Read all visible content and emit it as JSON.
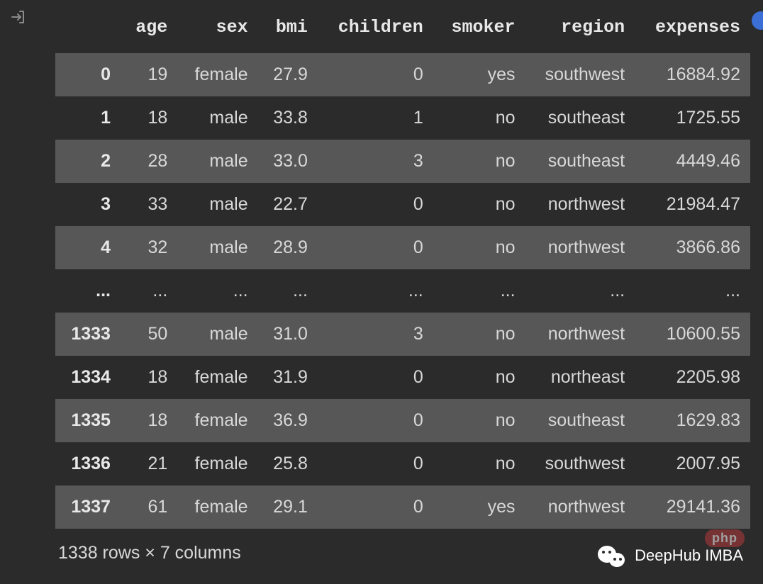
{
  "table": {
    "columns": [
      "age",
      "sex",
      "bmi",
      "children",
      "smoker",
      "region",
      "expenses"
    ],
    "rows": [
      {
        "index": "0",
        "cells": [
          "19",
          "female",
          "27.9",
          "0",
          "yes",
          "southwest",
          "16884.92"
        ],
        "striped": true
      },
      {
        "index": "1",
        "cells": [
          "18",
          "male",
          "33.8",
          "1",
          "no",
          "southeast",
          "1725.55"
        ],
        "striped": false
      },
      {
        "index": "2",
        "cells": [
          "28",
          "male",
          "33.0",
          "3",
          "no",
          "southeast",
          "4449.46"
        ],
        "striped": true
      },
      {
        "index": "3",
        "cells": [
          "33",
          "male",
          "22.7",
          "0",
          "no",
          "northwest",
          "21984.47"
        ],
        "striped": false
      },
      {
        "index": "4",
        "cells": [
          "32",
          "male",
          "28.9",
          "0",
          "no",
          "northwest",
          "3866.86"
        ],
        "striped": true
      },
      {
        "index": "...",
        "cells": [
          "...",
          "...",
          "...",
          "...",
          "...",
          "...",
          "..."
        ],
        "striped": false
      },
      {
        "index": "1333",
        "cells": [
          "50",
          "male",
          "31.0",
          "3",
          "no",
          "northwest",
          "10600.55"
        ],
        "striped": true
      },
      {
        "index": "1334",
        "cells": [
          "18",
          "female",
          "31.9",
          "0",
          "no",
          "northeast",
          "2205.98"
        ],
        "striped": false
      },
      {
        "index": "1335",
        "cells": [
          "18",
          "female",
          "36.9",
          "0",
          "no",
          "southeast",
          "1629.83"
        ],
        "striped": true
      },
      {
        "index": "1336",
        "cells": [
          "21",
          "female",
          "25.8",
          "0",
          "no",
          "southwest",
          "2007.95"
        ],
        "striped": false
      },
      {
        "index": "1337",
        "cells": [
          "61",
          "female",
          "29.1",
          "0",
          "yes",
          "northwest",
          "29141.36"
        ],
        "striped": true
      }
    ],
    "summary": "1338 rows × 7 columns"
  },
  "watermark": {
    "text": "DeepHub IMBA"
  },
  "php_badge": "php"
}
